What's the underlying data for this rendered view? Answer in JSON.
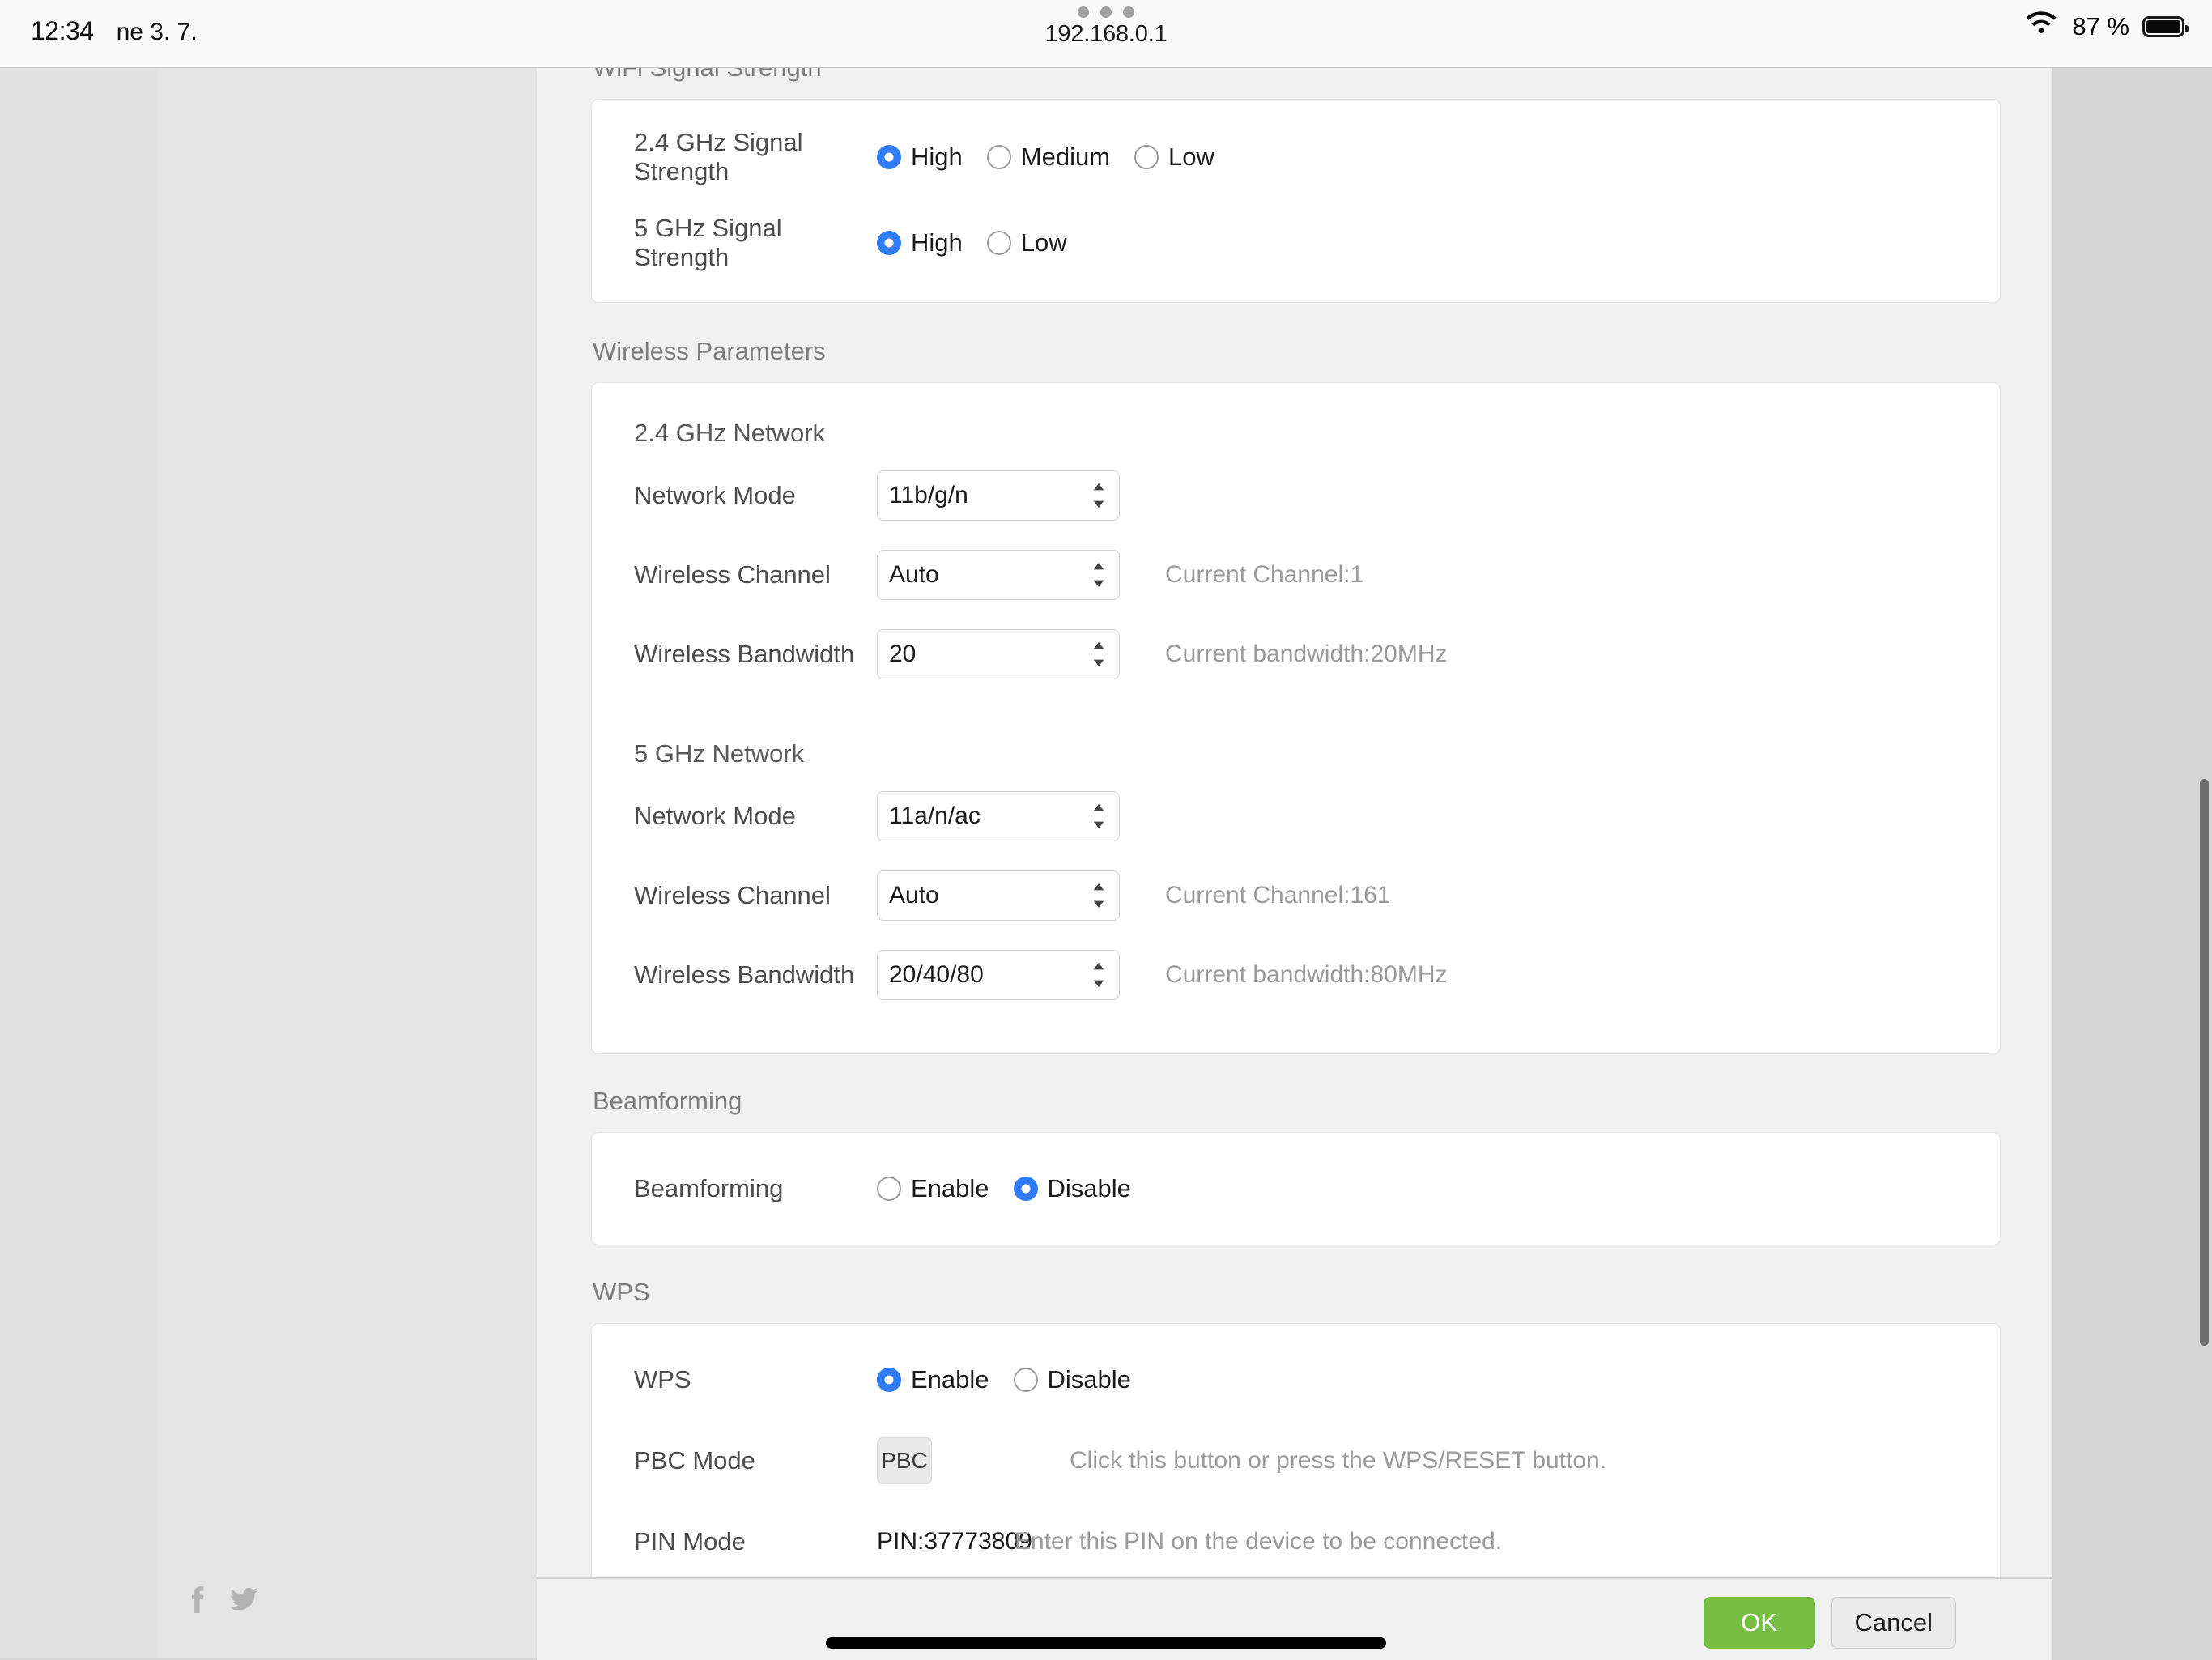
{
  "status_bar": {
    "time": "12:34",
    "date": "ne 3. 7.",
    "url": "192.168.0.1",
    "battery_percent": "87 %",
    "wifi_icon": "wifi-icon",
    "battery_icon": "battery-icon",
    "multitask_icon": "multitask-dots-icon"
  },
  "sections": {
    "wifi_signal": {
      "title": "WiFi Signal Strength",
      "rows": [
        {
          "label": "2.4 GHz Signal Strength",
          "options": [
            "High",
            "Medium",
            "Low"
          ],
          "selected": "High"
        },
        {
          "label": "5 GHz Signal Strength",
          "options": [
            "High",
            "Low"
          ],
          "selected": "High"
        }
      ]
    },
    "wireless_parameters": {
      "title": "Wireless Parameters",
      "groups": [
        {
          "heading": "2.4 GHz Network",
          "fields": [
            {
              "label": "Network Mode",
              "value": "11b/g/n",
              "hint": ""
            },
            {
              "label": "Wireless Channel",
              "value": "Auto",
              "hint": "Current Channel:1"
            },
            {
              "label": "Wireless Bandwidth",
              "value": "20",
              "hint": "Current bandwidth:20MHz"
            }
          ]
        },
        {
          "heading": "5 GHz Network",
          "fields": [
            {
              "label": "Network Mode",
              "value": "11a/n/ac",
              "hint": ""
            },
            {
              "label": "Wireless Channel",
              "value": "Auto",
              "hint": "Current Channel:161"
            },
            {
              "label": "Wireless Bandwidth",
              "value": "20/40/80",
              "hint": "Current bandwidth:80MHz"
            }
          ]
        }
      ]
    },
    "beamforming": {
      "title": "Beamforming",
      "row": {
        "label": "Beamforming",
        "options": [
          "Enable",
          "Disable"
        ],
        "selected": "Disable"
      }
    },
    "wps": {
      "title": "WPS",
      "toggle": {
        "label": "WPS",
        "options": [
          "Enable",
          "Disable"
        ],
        "selected": "Enable"
      },
      "pbc": {
        "label": "PBC Mode",
        "button_label": "PBC",
        "hint": "Click this button or press the WPS/RESET button."
      },
      "pin": {
        "label": "PIN Mode",
        "value": "PIN:37773809",
        "hint": "Enter this PIN on the device to be connected."
      }
    }
  },
  "footer": {
    "ok_label": "OK",
    "cancel_label": "Cancel"
  },
  "social": {
    "facebook_icon": "facebook-icon",
    "twitter_icon": "twitter-icon"
  },
  "colors": {
    "accent_radio": "#2f7cf6",
    "ok_button": "#76bf43",
    "page_bg": "#f1f1f1"
  }
}
